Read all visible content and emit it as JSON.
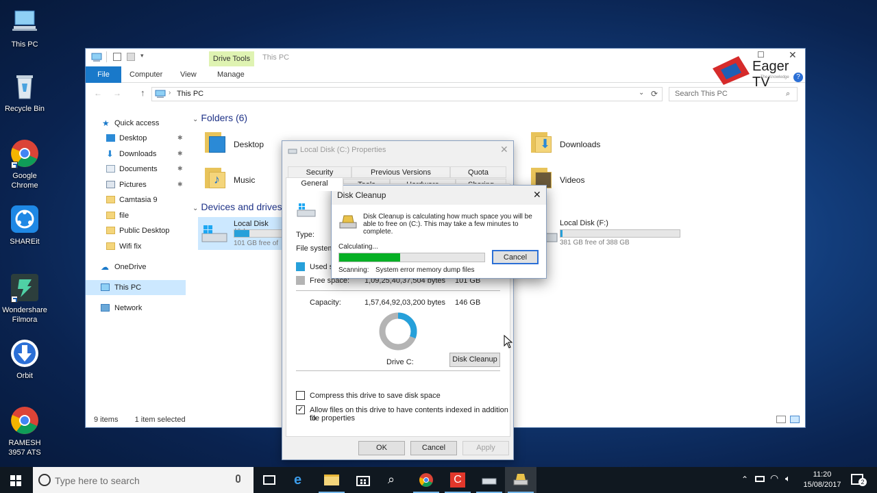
{
  "desktop": {
    "icons": [
      {
        "label": "This PC"
      },
      {
        "label": "Recycle Bin"
      },
      {
        "label": "Google Chrome"
      },
      {
        "label": "SHAREit"
      },
      {
        "label": "Wondershare Filmora"
      },
      {
        "label": "Orbit"
      },
      {
        "label": "RAMESH 3957 ATS"
      }
    ]
  },
  "watermark": {
    "text": "Eager TV",
    "tagline": "The Knowledge"
  },
  "explorer": {
    "title": "This PC",
    "contextual_tab": "Drive Tools",
    "tabs": {
      "file": "File",
      "computer": "Computer",
      "view": "View",
      "manage": "Manage"
    },
    "address": "This PC",
    "search_placeholder": "Search This PC",
    "nav": {
      "quick_access": "Quick access",
      "desktop": "Desktop",
      "downloads": "Downloads",
      "documents": "Documents",
      "pictures": "Pictures",
      "camtasia": "Camtasia 9",
      "file": "file",
      "public_desktop": "Public Desktop",
      "wifi_fix": "Wifi fix",
      "onedrive": "OneDrive",
      "this_pc": "This PC",
      "network": "Network"
    },
    "folders_header": "Folders (6)",
    "folders": {
      "desktop": "Desktop",
      "music": "Music",
      "downloads": "Downloads",
      "videos": "Videos"
    },
    "devices_header": "Devices and drives",
    "drive_c": {
      "label": "Local Disk (C:)",
      "free": "101 GB free of",
      "used_fraction": 0.31
    },
    "drive_f": {
      "label": "Local Disk (F:)",
      "free": "381 GB free of 388 GB",
      "used_fraction": 0.02
    },
    "status": {
      "items": "9 items",
      "selected": "1 item selected"
    }
  },
  "properties": {
    "title": "Local Disk (C:) Properties",
    "tabs_row1": {
      "security": "Security",
      "previous_versions": "Previous Versions",
      "quota": "Quota"
    },
    "tabs_row2": {
      "general": "General",
      "tools": "Tools",
      "hardware": "Hardware",
      "sharing": "Sharing"
    },
    "type_label": "Type:",
    "filesystem_label": "File system:",
    "used_label": "Used sp",
    "free_label": "Free space:",
    "free_bytes": "1,09,25,40,37,504 bytes",
    "free_gb": "101 GB",
    "capacity_label": "Capacity:",
    "capacity_bytes": "1,57,64,92,03,200 bytes",
    "capacity_gb": "146 GB",
    "drive_label": "Drive C:",
    "disk_cleanup_button": "Disk Cleanup",
    "compress_label": "Compress this drive to save disk space",
    "index_label_1": "Allow files on this drive to have contents indexed in addition to",
    "index_label_2": "file properties",
    "ok": "OK",
    "cancel": "Cancel",
    "apply": "Apply",
    "used_fraction": 0.31
  },
  "cleanup": {
    "title": "Disk Cleanup",
    "message_1": "Disk Cleanup is calculating how much space you will be",
    "message_2": "able to free on  (C:). This may take a few minutes to",
    "message_3": "complete.",
    "calculating": "Calculating...",
    "cancel": "Cancel",
    "scanning_label": "Scanning:",
    "scanning_item": "System error memory dump files",
    "progress": 0.42
  },
  "taskbar": {
    "search_placeholder": "Type here to search",
    "time": "11:20",
    "date": "15/08/2017",
    "notification_count": "2"
  },
  "colors": {
    "accent": "#1979ca",
    "drive_bar": "#26a0da",
    "progress": "#06b025",
    "drive_tools": "#dff3b2"
  }
}
